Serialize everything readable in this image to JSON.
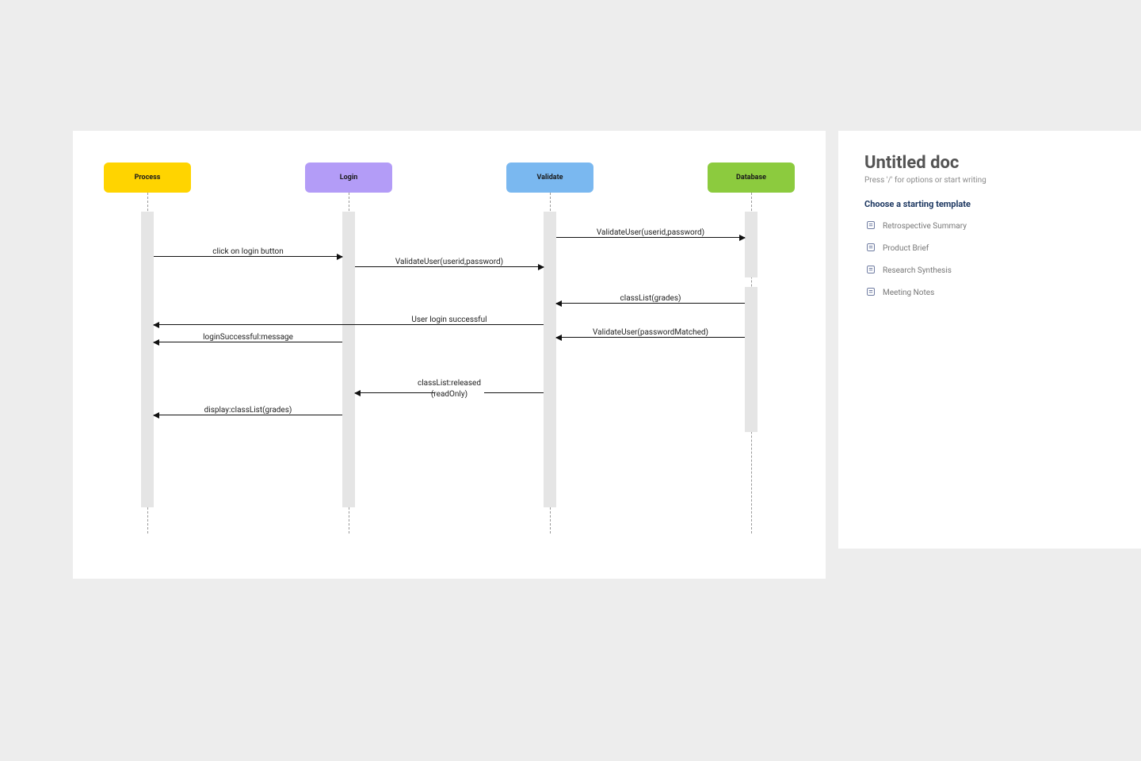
{
  "diagram": {
    "participants": {
      "process": {
        "label": "Process",
        "color": "#ffd400"
      },
      "login": {
        "label": "Login",
        "color": "#b39cf7"
      },
      "validate": {
        "label": "Validate",
        "color": "#7ab8f0"
      },
      "database": {
        "label": "Database",
        "color": "#8ccb3e"
      }
    },
    "messages": [
      {
        "from": "process",
        "to": "login",
        "label": "click on login button"
      },
      {
        "from": "login",
        "to": "validate",
        "label": "ValidateUser(userid,password)"
      },
      {
        "from": "validate",
        "to": "database",
        "label": "ValidateUser(userid,password)"
      },
      {
        "from": "database",
        "to": "validate",
        "label": "classList(grades)"
      },
      {
        "from": "login",
        "to": "process",
        "label": "User login successful"
      },
      {
        "from": "database",
        "to": "validate",
        "label": "ValidateUser(passwordMatched)"
      },
      {
        "from": "login",
        "to": "process",
        "label": "loginSuccessful:message"
      },
      {
        "from": "validate",
        "to": "login",
        "label": "classList:released (readOnly)"
      },
      {
        "from": "login",
        "to": "process",
        "label": "display:classList(grades)"
      }
    ]
  },
  "doc": {
    "title": "Untitled doc",
    "hint": "Press '/' for options or start writing",
    "section_heading": "Choose a starting template",
    "templates": [
      {
        "label": "Retrospective Summary"
      },
      {
        "label": "Product Brief"
      },
      {
        "label": "Research Synthesis"
      },
      {
        "label": "Meeting Notes"
      }
    ]
  }
}
